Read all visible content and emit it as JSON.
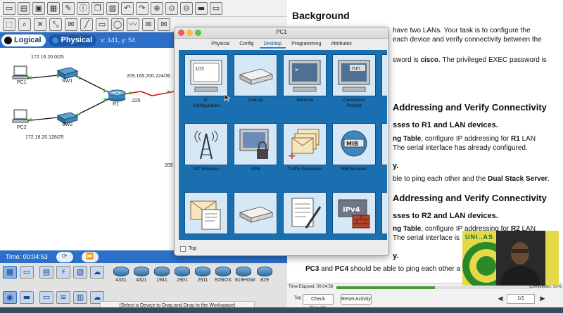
{
  "pt": {
    "tabs": [
      {
        "label": "Logical",
        "active": true
      },
      {
        "label": "Physical",
        "active": false
      }
    ],
    "coords": "x: 141, y: 54",
    "network": {
      "lan1": "172.16.20.0/25",
      "lan2": "172.16.20.128/25",
      "serial_net": "209.165.200.224/30",
      "r1_iface": ".225",
      "cut_label": "209"
    },
    "devices": [
      "PC1",
      "SW1",
      "R1",
      "PC2",
      "SW2"
    ],
    "status": {
      "time": "Time: 00:04:53"
    },
    "palette": {
      "models": [
        "4331",
        "4321",
        "1941",
        "2901",
        "2911",
        "819IOX",
        "819HGW",
        "829"
      ],
      "hint": "(Select a Device to Drag and Drop to the Workspace)"
    }
  },
  "doc": {
    "title": "Background",
    "lines": [
      "have two LANs. Your task is to configure the",
      "each device and verify connectivity between the",
      "sword is cisco. The privileged EXEC password is"
    ],
    "bold_word": "cisco",
    "h2_1": "Addressing and Verify Connectivity",
    "h3_1": "sses to R1 and LAN devices.",
    "para1a_prefix": "ng Table",
    "para1a_mid": ", configure IP addressing for ",
    "para1a_bold": "R1",
    "para1a_end": " LAN",
    "para1b": "The serial interface has already configured.",
    "frag1": "y.",
    "para1c_prefix": "ble to ping each other and the ",
    "para1c_bold": "Dual Stack Server",
    "para1c_end": ".",
    "h2_2": "Addressing and Verify Connectivity",
    "h3_2": "sses to R2 and LAN devices.",
    "para2a_prefix": "ng Table",
    "para2a_mid": ", configure IP addressing for ",
    "para2a_bold": "R2",
    "para2a_end": " LAN",
    "para2b": "The serial interface is",
    "frag2": "y.",
    "para2c_bold1": "PC3",
    "para2c_and": " and ",
    "para2c_bold2": "PC4",
    "para2c_end": " should be able to ping each other a",
    "bottom": {
      "time_elapsed": "Time Elapsed: 00:04:58",
      "completion": "Completion: 50%",
      "completion_value": 0.5,
      "top_label": "Top",
      "check_results": "Check Results",
      "reset_activity": "Reset Activity",
      "page": "1/1"
    }
  },
  "pc1": {
    "title": "PC1",
    "tabs": [
      {
        "label": "Physical",
        "active": false
      },
      {
        "label": "Config",
        "active": false
      },
      {
        "label": "Desktop",
        "active": true
      },
      {
        "label": "Programming",
        "active": false
      },
      {
        "label": "Attributes",
        "active": false
      }
    ],
    "apps": [
      {
        "name": "IP Configuration",
        "line1": "IP",
        "line2": "Configuration",
        "badge": "105"
      },
      {
        "name": "Dial-up",
        "line1": "Dial-up",
        "line2": ""
      },
      {
        "name": "Terminal",
        "line1": "Terminal",
        "line2": "",
        "prompt": ">"
      },
      {
        "name": "Command Prompt",
        "line1": "Command",
        "line2": "Prompt",
        "badge": "run"
      },
      {
        "name": "PC Wireless",
        "line1": "PC Wireless",
        "line2": ""
      },
      {
        "name": "VPN",
        "line1": "VPN",
        "line2": ""
      },
      {
        "name": "Traffic Generator",
        "line1": "Traffic Generator",
        "line2": ""
      },
      {
        "name": "MIB Browser",
        "line1": "MIB Browser",
        "line2": "",
        "badge": "MIB"
      },
      {
        "name": "Email",
        "line1": "",
        "line2": ""
      },
      {
        "name": "PPPoE Dialer",
        "line1": "",
        "line2": ""
      },
      {
        "name": "Text Editor",
        "line1": "",
        "line2": ""
      },
      {
        "name": "Firewall",
        "line1": "",
        "line2": "",
        "badge": "IPv4"
      }
    ],
    "top_label": "Top"
  },
  "webcam": {
    "logo_text": "UNI..AS"
  }
}
